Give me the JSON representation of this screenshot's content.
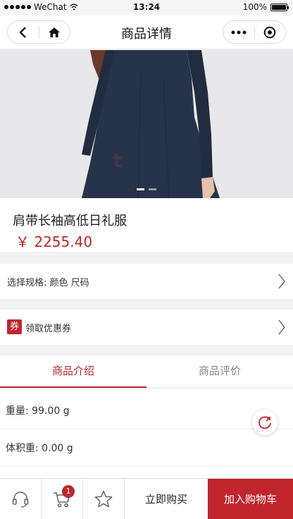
{
  "status_bar": {
    "carrier": "WeChat",
    "time": "13:24",
    "battery": "100%",
    "battery_level": 1.0
  },
  "nav": {
    "title": "商品详情",
    "back_icon": "back-icon",
    "home_icon": "home-icon",
    "more_icon": "more-icon",
    "close_icon": "target-icon"
  },
  "product": {
    "name": "肩带长袖高低日礼服",
    "price": "￥ 2255.40",
    "carousel_index": 1,
    "carousel_total": 2
  },
  "spec": {
    "label": "选择规格: 颜色 尺码"
  },
  "coupon": {
    "badge": "券",
    "label": "领取优惠券"
  },
  "tabs": [
    {
      "label": "商品介绍",
      "active": true
    },
    {
      "label": "商品评价",
      "active": false
    }
  ],
  "details": {
    "weight": "重量: 99.00 g",
    "volume": "体积重: 0.00 g"
  },
  "bottom_bar": {
    "service_icon": "headset-icon",
    "cart_icon": "cart-icon",
    "cart_count": "1",
    "favorite_icon": "star-icon",
    "buy_now": "立即购买",
    "add_to_cart": "加入购物车"
  },
  "colors": {
    "accent": "#c0252e",
    "dress": "#27334a",
    "image_bg": "#e9e9eb"
  }
}
